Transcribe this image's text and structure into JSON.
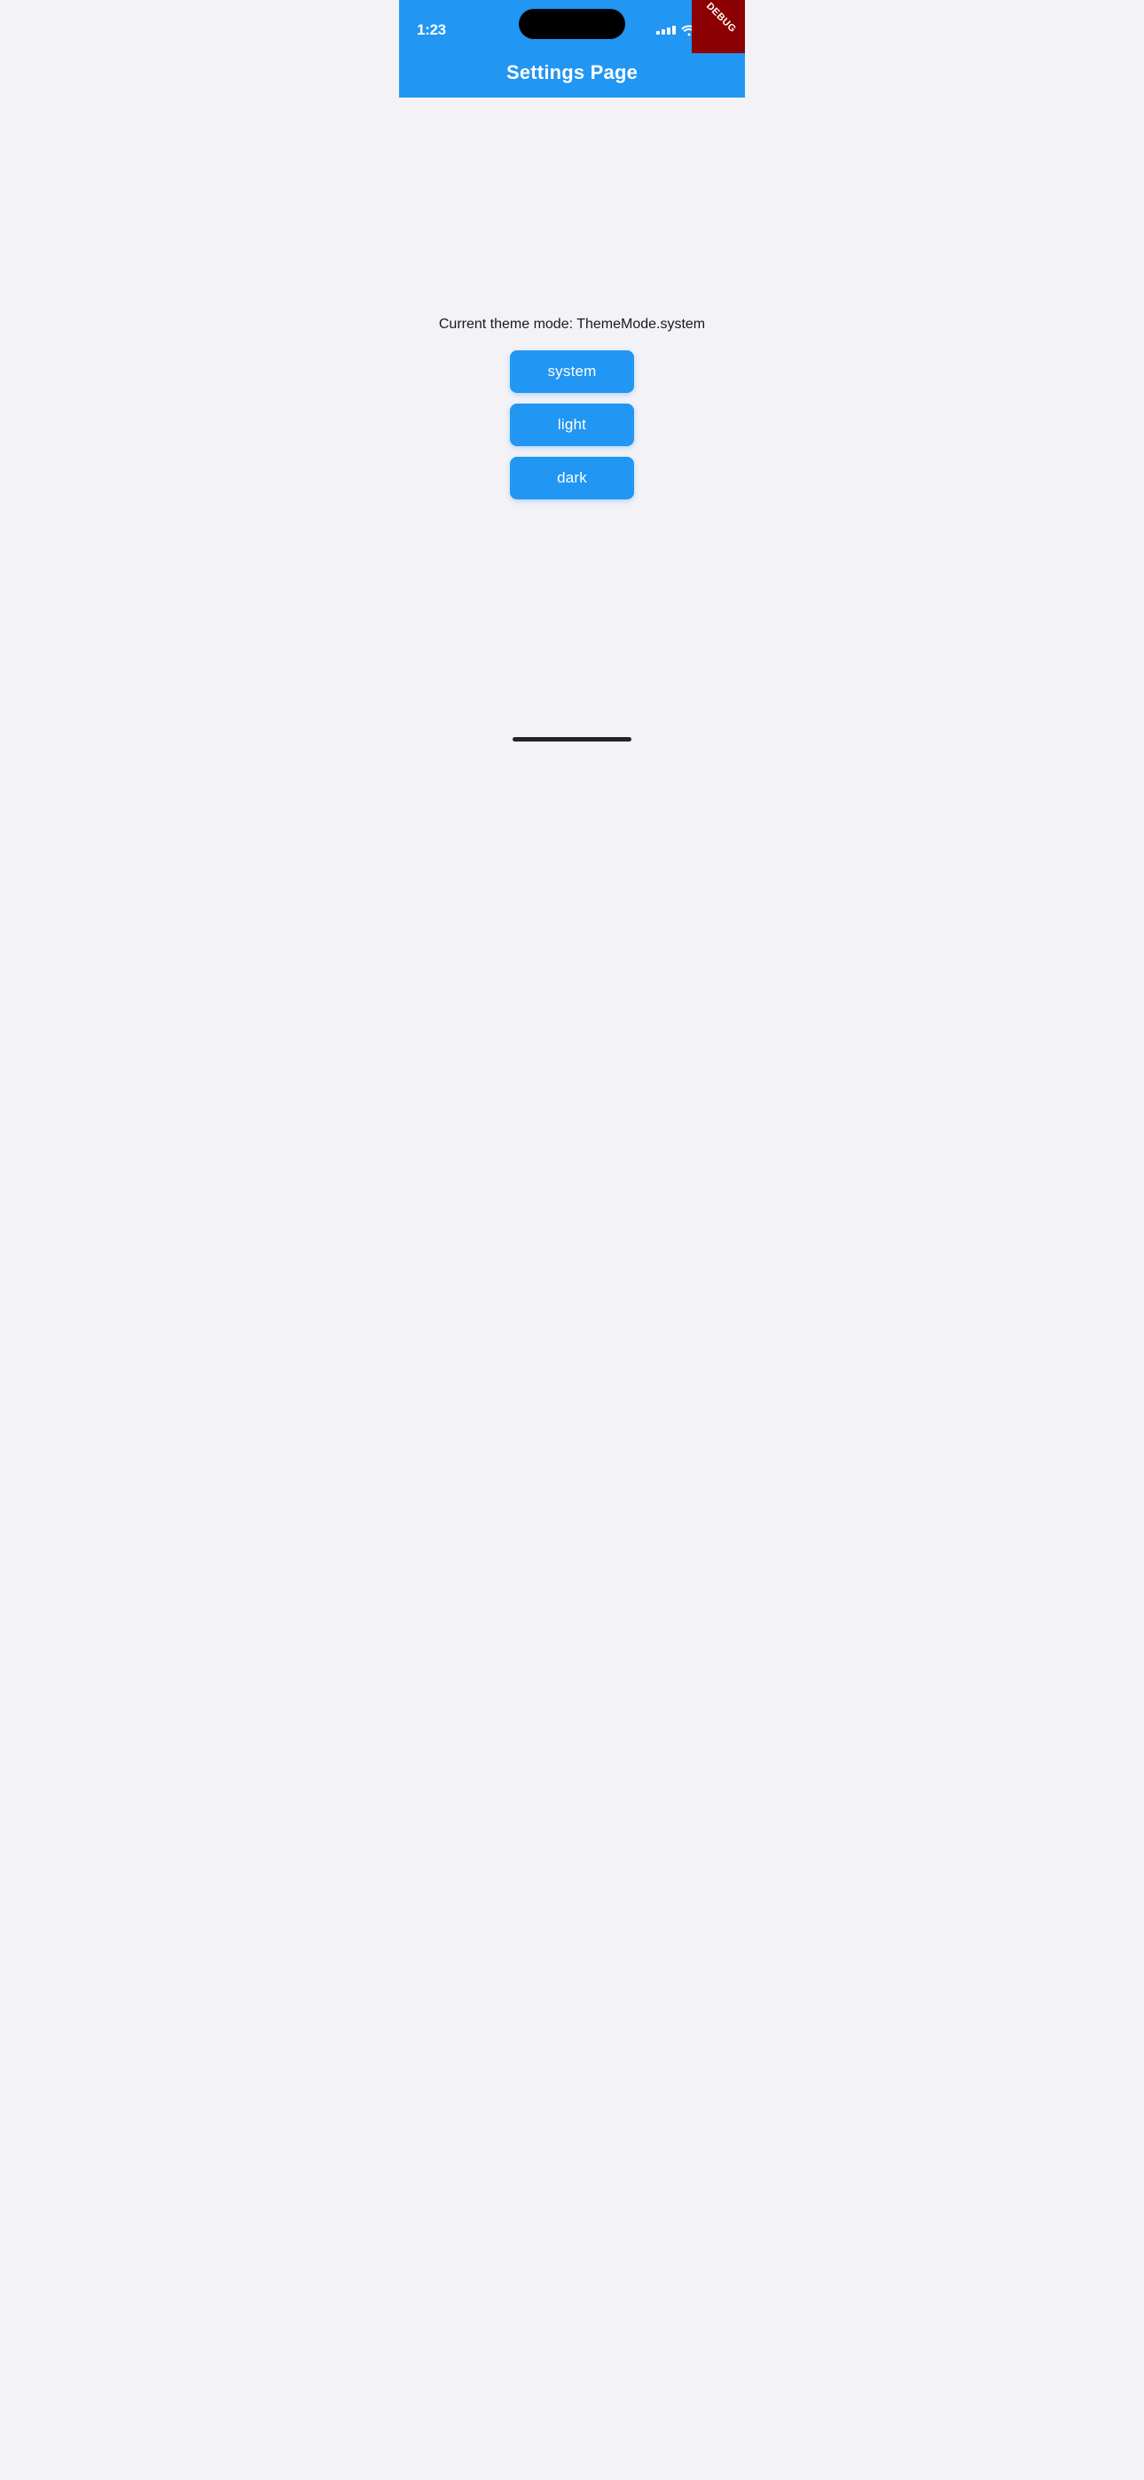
{
  "statusBar": {
    "time": "1:23",
    "debugLabel": "DEBUG"
  },
  "appBar": {
    "title": "Settings Page"
  },
  "main": {
    "themeStatusText": "Current theme mode: ThemeMode.system",
    "buttons": [
      {
        "label": "system",
        "id": "system"
      },
      {
        "label": "light",
        "id": "light"
      },
      {
        "label": "dark",
        "id": "dark"
      }
    ]
  },
  "colors": {
    "blue": "#2196f3",
    "debugRed": "#8b0000",
    "background": "#f2f2f7"
  }
}
